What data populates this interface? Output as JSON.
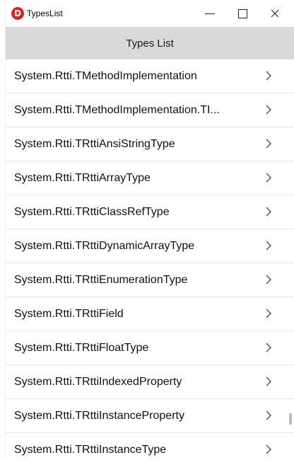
{
  "window": {
    "title": "TypesList",
    "app_icon_letter": "D",
    "icons": {
      "app": "delphi-app-icon",
      "minimize": "minimize-icon",
      "maximize": "maximize-icon",
      "close": "close-icon",
      "chevron": "chevron-right-icon"
    },
    "close_glyph": "×"
  },
  "header": {
    "title": "Types List"
  },
  "list": {
    "items": [
      {
        "label": "System.Rtti.TMethodImplementation"
      },
      {
        "label": "System.Rtti.TMethodImplementation.TI..."
      },
      {
        "label": "System.Rtti.TRttiAnsiStringType"
      },
      {
        "label": "System.Rtti.TRttiArrayType"
      },
      {
        "label": "System.Rtti.TRttiClassRefType"
      },
      {
        "label": "System.Rtti.TRttiDynamicArrayType"
      },
      {
        "label": "System.Rtti.TRttiEnumerationType"
      },
      {
        "label": "System.Rtti.TRttiField"
      },
      {
        "label": "System.Rtti.TRttiFloatType"
      },
      {
        "label": "System.Rtti.TRttiIndexedProperty"
      },
      {
        "label": "System.Rtti.TRttiInstanceProperty"
      },
      {
        "label": "System.Rtti.TRttiInstanceType"
      }
    ]
  },
  "colors": {
    "header_bg": "#d9d9d9",
    "app_icon": "#e02020",
    "chevron": "#666666"
  }
}
